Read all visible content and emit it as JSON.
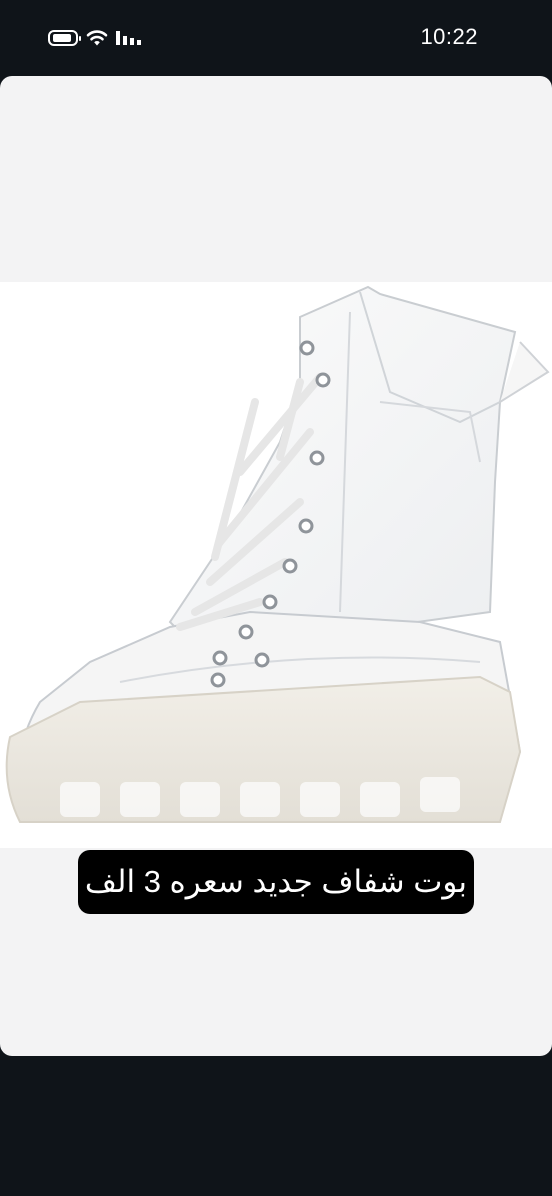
{
  "status_bar": {
    "time": "10:22",
    "icons": [
      "battery-icon",
      "wifi-icon",
      "signal-icon"
    ]
  },
  "story": {
    "image_subject": "boot",
    "caption": "بوت شفاف جديد سعره 3 الف"
  },
  "colors": {
    "background": "#0f1419",
    "card": "#f3f3f4",
    "caption_bg": "#000000",
    "caption_text": "#ffffff"
  }
}
